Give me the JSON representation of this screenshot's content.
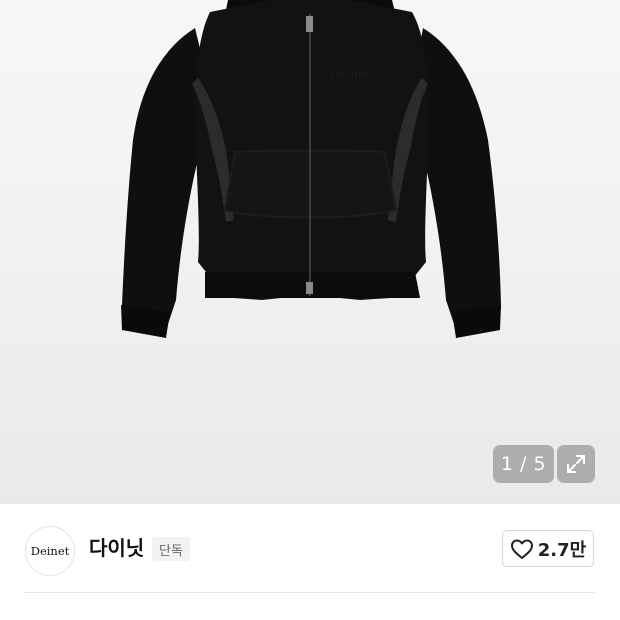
{
  "product": {
    "image_description_icon": "hooded-zip-jacket-photo",
    "image_counter": "1 / 5",
    "chest_logo_text": "Deinet"
  },
  "brand": {
    "logo_text": "Deinet",
    "name": "다이닛",
    "badge": "단독",
    "like_count": "2.7만"
  },
  "icons": {
    "fullscreen": "expand-arrows-icon",
    "like": "heart-outline-icon"
  },
  "colors": {
    "jacket": "#0e0e10",
    "panel": "#2c2c2e",
    "overlay": "#969696"
  }
}
